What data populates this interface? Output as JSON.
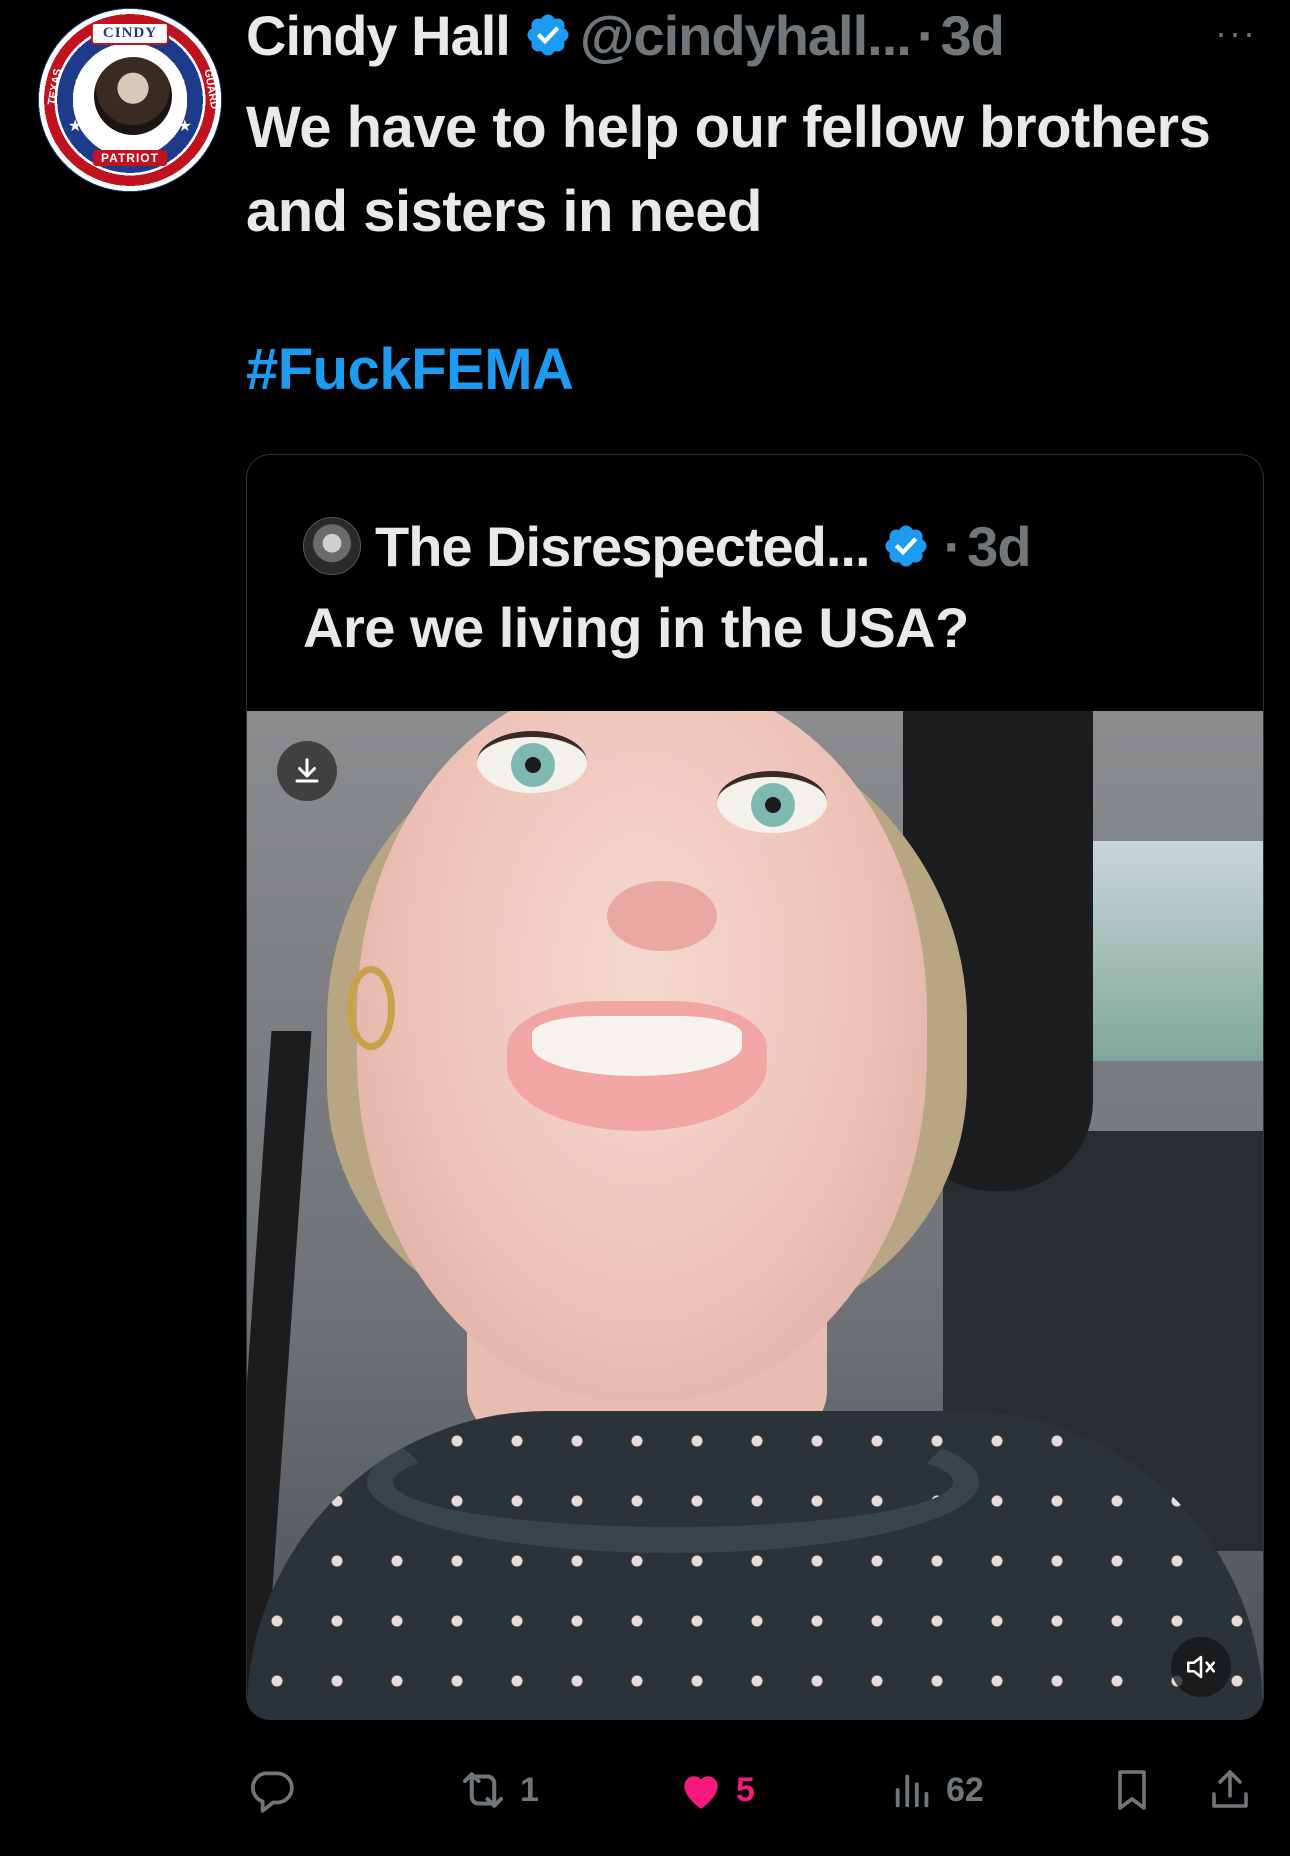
{
  "tweet": {
    "display_name": "Cindy Hall",
    "handle": "@cindyhall...",
    "separator": "·",
    "time": "3d",
    "more_label": "···",
    "text": "We have to help our fellow brothers and sisters in need",
    "hashtag": "#FuckFEMA",
    "verified_color": "#1d9bf0",
    "avatar": {
      "badge_top": "CINDY",
      "badge_bottom": "PATRIOT",
      "side_left": "TEXAS",
      "side_right": "GUARD"
    }
  },
  "quote": {
    "display_name": "The Disrespected...",
    "separator": "·",
    "time": "3d",
    "text": "Are we living in the USA?",
    "media": {
      "type": "video",
      "download_icon": "download-icon",
      "mute_icon": "volume-muted-icon"
    }
  },
  "actions": {
    "reply": {
      "icon": "reply-icon",
      "count": ""
    },
    "retweet": {
      "icon": "retweet-icon",
      "count": "1"
    },
    "like": {
      "icon": "heart-icon",
      "count": "5",
      "color": "#f91880",
      "liked": true
    },
    "views": {
      "icon": "views-icon",
      "count": "62"
    },
    "bookmark": {
      "icon": "bookmark-icon"
    },
    "share": {
      "icon": "share-icon"
    }
  }
}
